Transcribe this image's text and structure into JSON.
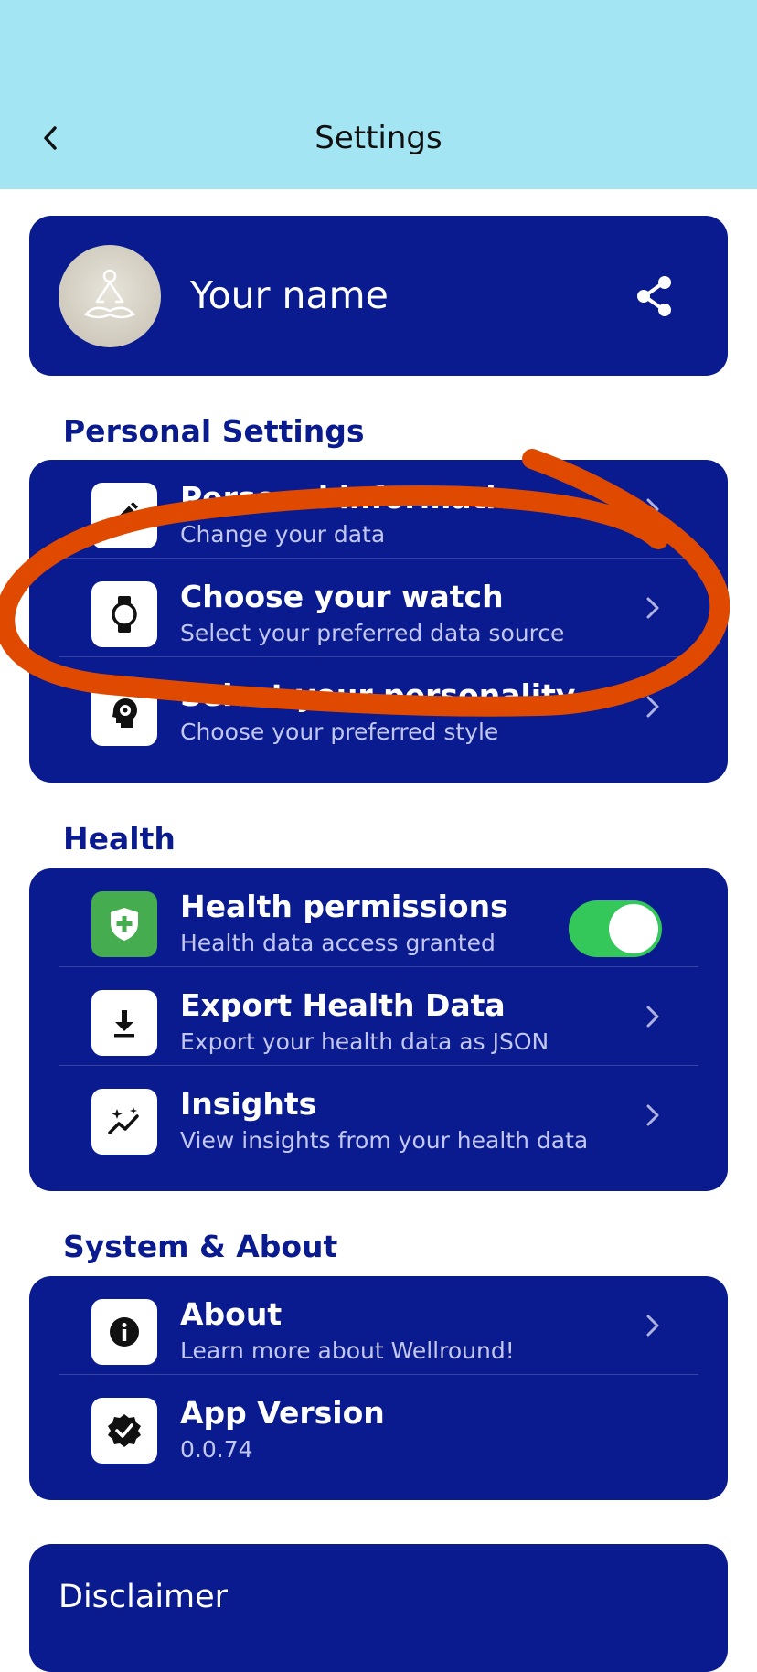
{
  "header": {
    "title": "Settings"
  },
  "profile": {
    "name": "Your name"
  },
  "sections": {
    "personal": {
      "title": "Personal Settings",
      "items": [
        {
          "title": "Personal information",
          "subtitle": "Change your data"
        },
        {
          "title": "Choose your watch",
          "subtitle": "Select your preferred data source"
        },
        {
          "title": "Select your personality",
          "subtitle": "Choose your preferred style"
        }
      ]
    },
    "health": {
      "title": "Health",
      "items": [
        {
          "title": "Health permissions",
          "subtitle": "Health data access granted",
          "toggle_on": true
        },
        {
          "title": "Export Health Data",
          "subtitle": "Export your health data as JSON"
        },
        {
          "title": "Insights",
          "subtitle": "View insights from your health data"
        }
      ]
    },
    "system": {
      "title": "System & About",
      "items": [
        {
          "title": "About",
          "subtitle": "Learn more about Wellround!"
        },
        {
          "title": "App Version",
          "subtitle": "0.0.74"
        }
      ]
    }
  },
  "disclaimer": {
    "title": "Disclaimer"
  },
  "colors": {
    "header_bg": "#a4e5f3",
    "card_bg": "#0a1a8f",
    "toggle_on": "#34c759",
    "annotation": "#e04a00"
  }
}
